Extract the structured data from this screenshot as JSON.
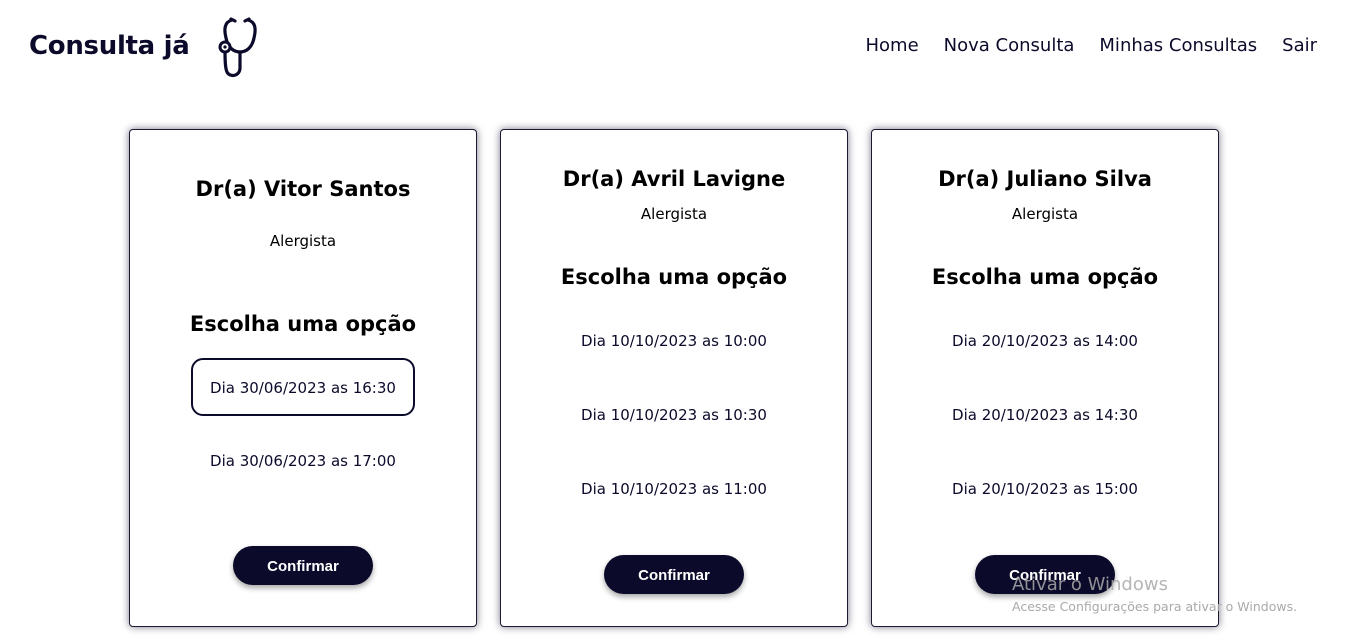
{
  "header": {
    "brand": "Consulta já",
    "logo_icon": "stethoscope-icon",
    "nav": [
      "Home",
      "Nova Consulta",
      "Minhas Consultas",
      "Sair"
    ]
  },
  "cards": [
    {
      "doctor": "Dr(a) Vitor Santos",
      "specialty": "Alergista",
      "prompt": "Escolha uma opção",
      "slots": [
        "Dia 30/06/2023 as 16:30",
        "Dia 30/06/2023 as 17:00"
      ],
      "selected_slot": 0,
      "confirm": "Confirmar"
    },
    {
      "doctor": "Dr(a) Avril Lavigne",
      "specialty": "Alergista",
      "prompt": "Escolha uma opção",
      "slots": [
        "Dia 10/10/2023 as 10:00",
        "Dia 10/10/2023 as 10:30",
        "Dia 10/10/2023 as 11:00"
      ],
      "confirm": "Confirmar"
    },
    {
      "doctor": "Dr(a) Juliano Silva",
      "specialty": "Alergista",
      "prompt": "Escolha uma opção",
      "slots": [
        "Dia 20/10/2023 as 14:00",
        "Dia 20/10/2023 as 14:30",
        "Dia 20/10/2023 as 15:00"
      ],
      "confirm": "Confirmar"
    }
  ],
  "watermark": {
    "title": "Ativar o Windows",
    "subtitle": "Acesse Configurações para ativar o Windows."
  },
  "colors": {
    "primary": "#0b0a2a",
    "background": "#ffffff"
  }
}
